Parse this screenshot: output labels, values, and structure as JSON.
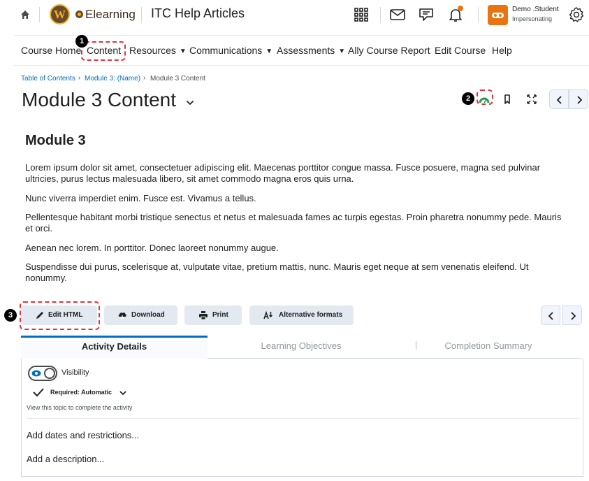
{
  "topbar": {
    "brand": "Elearning",
    "logo_letter": "W",
    "site_title": "ITC Help Articles",
    "user_name": "Demo .Student",
    "user_role": "Impersonating",
    "icons": [
      "home-icon",
      "apps-grid-icon",
      "mail-icon",
      "chat-icon",
      "bell-icon",
      "avatar-icon",
      "gear-icon"
    ]
  },
  "nav": {
    "items": [
      {
        "label": "Course Home"
      },
      {
        "label": "Content"
      },
      {
        "label": "Resources",
        "dropdown": true
      },
      {
        "label": "Communications",
        "dropdown": true
      },
      {
        "label": "Assessments",
        "dropdown": true
      },
      {
        "label": "Ally Course Report"
      },
      {
        "label": "Edit Course"
      },
      {
        "label": "Help"
      }
    ]
  },
  "breadcrumb": {
    "items": [
      "Table of Contents",
      "Module 3: (Name)",
      "Module 3 Content"
    ],
    "separator": "›"
  },
  "page": {
    "title": "Module 3 Content"
  },
  "content": {
    "heading": "Module 3",
    "paragraphs": [
      "Lorem ipsum dolor sit amet, consectetuer adipiscing elit. Maecenas porttitor congue massa. Fusce posuere, magna sed pulvinar ultricies, purus lectus malesuada libero, sit amet commodo magna eros quis urna.",
      "Nunc viverra imperdiet enim. Fusce est. Vivamus a tellus.",
      "Pellentesque habitant morbi tristique senectus et netus et malesuada fames ac turpis egestas. Proin pharetra nonummy pede. Mauris et orci.",
      "Aenean nec lorem. In porttitor. Donec laoreet nonummy augue.",
      "Suspendisse dui purus, scelerisque at, vulputate vitae, pretium mattis, nunc. Mauris eget neque at sem venenatis eleifend. Ut nonummy."
    ]
  },
  "actions": {
    "edit_html": "Edit HTML",
    "download": "Download",
    "print": "Print",
    "alternative_formats": "Alternative formats"
  },
  "annotations": [
    "1",
    "2",
    "3"
  ],
  "tabs": [
    {
      "label": "Activity Details",
      "active": true
    },
    {
      "label": "Learning Objectives",
      "active": false
    },
    {
      "label": "Completion Summary",
      "active": false
    }
  ],
  "details": {
    "visibility_label": "Visibility",
    "visibility_on": true,
    "required_label": "Required: Automatic",
    "required_hint": "View this topic to complete the activity",
    "add_dates": "Add dates and restrictions...",
    "add_description": "Add a description..."
  },
  "colors": {
    "accent": "#006fbf",
    "brand_gold": "#f0b323",
    "brand_brown": "#6a4a2a",
    "avatar": "#e87511",
    "annotation": "#e0323e",
    "ally_green": "#2e9a57"
  }
}
